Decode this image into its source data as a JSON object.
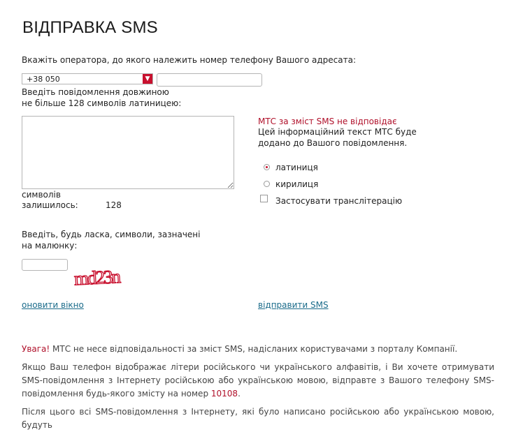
{
  "page_title": "ВІДПРАВКА SMS",
  "operator_prompt": "Вкажіть оператора, до якого належить номер телефону Вашого адресата:",
  "operator_select": {
    "value": "+38 050"
  },
  "phone_input": {
    "value": ""
  },
  "message_prompt_line1": "Введіть повідомлення довжиною",
  "message_prompt_line2": "не більше 128  символів латиницею:",
  "message_textarea": {
    "value": ""
  },
  "remaining": {
    "label_line1": "символів",
    "label_line2": "залишилось:",
    "count": "128"
  },
  "mts_notice": {
    "title": "МТС за зміст SMS не відповідає",
    "line1": "Цей інформаційний текст МТС буде",
    "line2": "додано до Вашого повідомлення."
  },
  "encoding": {
    "latin": "латиниця",
    "cyrillic": "кирилиця",
    "selected": "latin"
  },
  "transliteration_label": "Застосувати транслітерацію",
  "captcha_prompt_line1": "Введіть, будь ласка, символи, зазначені",
  "captcha_prompt_line2": "на малюнку:",
  "captcha_input": {
    "value": ""
  },
  "captcha_text": "md23n",
  "refresh_link": "оновити вікно",
  "send_link": "відправити SMS",
  "footer": {
    "warning_word": "Увага!",
    "warning_text": " МТС не несе відповідальності за зміст SMS, надісланих користувачами з порталу Компанії.",
    "para2_text": "Якщо Ваш телефон відображає літери російського чи українського алфавітів, і Ви хочете отримувати SMS-повідомлення з Інтернету російською або українською мовою, відправте з Вашого телефону SMS-повідомлення будь-якого змісту на номер ",
    "para2_number": "10108",
    "para2_end": ".",
    "para3_text": "Після цього всі SMS-повідомлення з Інтернету, які було написано російською або українською мовою, будуть"
  },
  "colors": {
    "accent_red": "#c8102e",
    "link": "#1a6b8a"
  }
}
